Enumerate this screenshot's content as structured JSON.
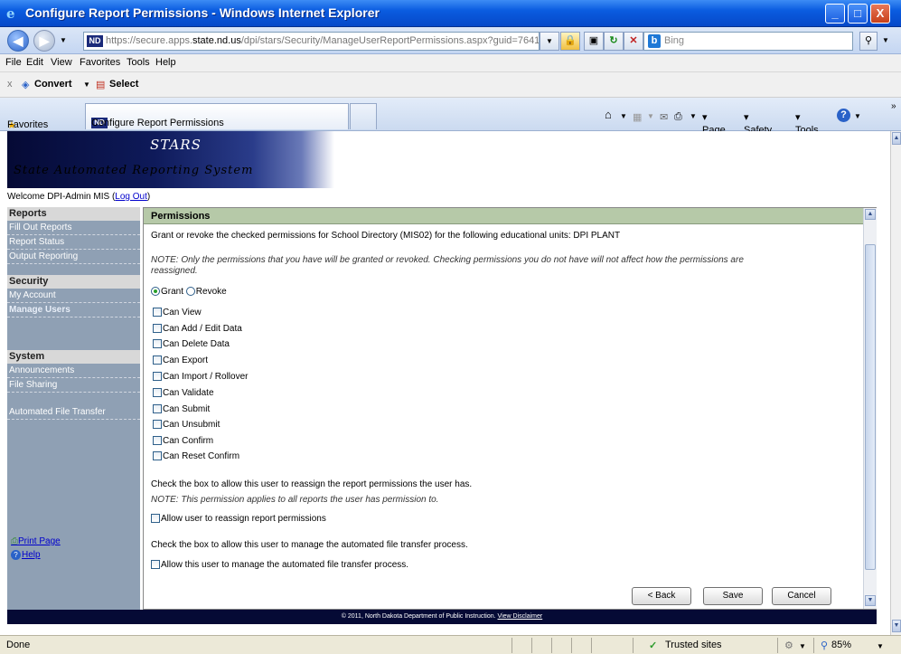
{
  "window": {
    "title": "Configure Report Permissions - Windows Internet Explorer",
    "min": "_",
    "max": "□",
    "close": "X"
  },
  "address": {
    "url_prefix": "https://secure.apps.",
    "url_domain": "state.nd.us",
    "url_path": "/dpi/stars/Security/ManageUserReportPermissions.aspx?guid=7641",
    "search_placeholder": "Bing"
  },
  "menu": [
    "File",
    "Edit",
    "View",
    "Favorites",
    "Tools",
    "Help"
  ],
  "toolbar2": {
    "close": "x",
    "convert": "Convert",
    "select": "Select"
  },
  "favbar": {
    "favorites": "Favorites",
    "tab_title": "Configure Report Permissions",
    "page": "Page",
    "safety": "Safety",
    "tools": "Tools"
  },
  "banner": {
    "stars": "STARS",
    "subtitle": "State Automated Reporting System"
  },
  "welcome": {
    "text": "Welcome DPI-Admin MIS (",
    "logout": "Log Out",
    "close_paren": ")"
  },
  "sidebar": {
    "reports_head": "Reports",
    "reports": [
      "Fill Out Reports",
      "Report Status",
      "Output Reporting"
    ],
    "security_head": "Security",
    "security": [
      "My Account",
      "Manage Users"
    ],
    "system_head": "System",
    "system": [
      "Announcements",
      "File Sharing"
    ],
    "aft": "Automated File Transfer",
    "print": "Print Page",
    "help": "Help"
  },
  "permissions": {
    "header": "Permissions",
    "intro": "Grant or revoke the checked permissions for School Directory (MIS02) for the following educational units: DPI PLANT",
    "note1": "NOTE: Only the permissions that you have will be granted or revoked. Checking permissions you do not have will not affect how the permissions are",
    "note1b": "reassigned.",
    "grant": "Grant",
    "revoke": "Revoke",
    "items": [
      "Can View",
      "Can Add / Edit Data",
      "Can Delete Data",
      "Can Export",
      "Can Import / Rollover",
      "Can Validate",
      "Can Submit",
      "Can Unsubmit",
      "Can Confirm",
      "Can Reset Confirm"
    ],
    "reassign_text": "Check the box to allow this user to reassign the report permissions the user has.",
    "note2": "NOTE: This permission applies to all reports the user has permission to.",
    "reassign_label": "Allow user to reassign report permissions",
    "aft_text": "Check the box to allow this user to manage the automated file transfer process.",
    "aft_label": "Allow this user to manage the automated file transfer process.",
    "back": "< Back",
    "save": "Save",
    "cancel": "Cancel"
  },
  "footer": {
    "text": "© 2011, North Dakota Department of Public Instruction.",
    "link": "View Disclaimer"
  },
  "status": {
    "left": "Done",
    "zone": "Trusted sites",
    "zoom": "85%"
  }
}
